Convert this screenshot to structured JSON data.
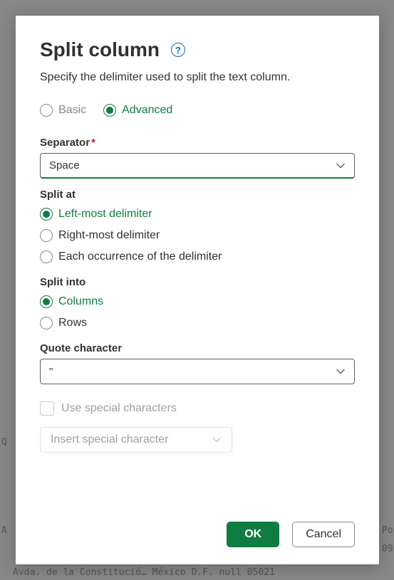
{
  "dialog": {
    "title": "Split column",
    "subtitle": "Specify the delimiter used to split the text column.",
    "help_icon_label": "?"
  },
  "mode": {
    "basic_label": "Basic",
    "advanced_label": "Advanced",
    "selected": "advanced"
  },
  "separator": {
    "label": "Separator",
    "required_mark": "*",
    "value": "Space"
  },
  "split_at": {
    "label": "Split at",
    "options": {
      "left": "Left-most delimiter",
      "right": "Right-most delimiter",
      "each": "Each occurrence of the delimiter"
    },
    "selected": "left"
  },
  "split_into": {
    "label": "Split into",
    "options": {
      "columns": "Columns",
      "rows": "Rows"
    },
    "selected": "columns"
  },
  "quote_char": {
    "label": "Quote character",
    "value": "\""
  },
  "special": {
    "use_label": "Use special characters",
    "insert_label": "Insert special character"
  },
  "buttons": {
    "ok": "OK",
    "cancel": "Cancel"
  },
  "background": {
    "row_text": "Avda. de la Constitució…  México D.F.          null  05021",
    "q_text": "Q",
    "a_text": "A",
    "po_text": "Po",
    "num_text": "09"
  },
  "colors": {
    "accent": "#107c41",
    "link": "#0f6cbd"
  }
}
